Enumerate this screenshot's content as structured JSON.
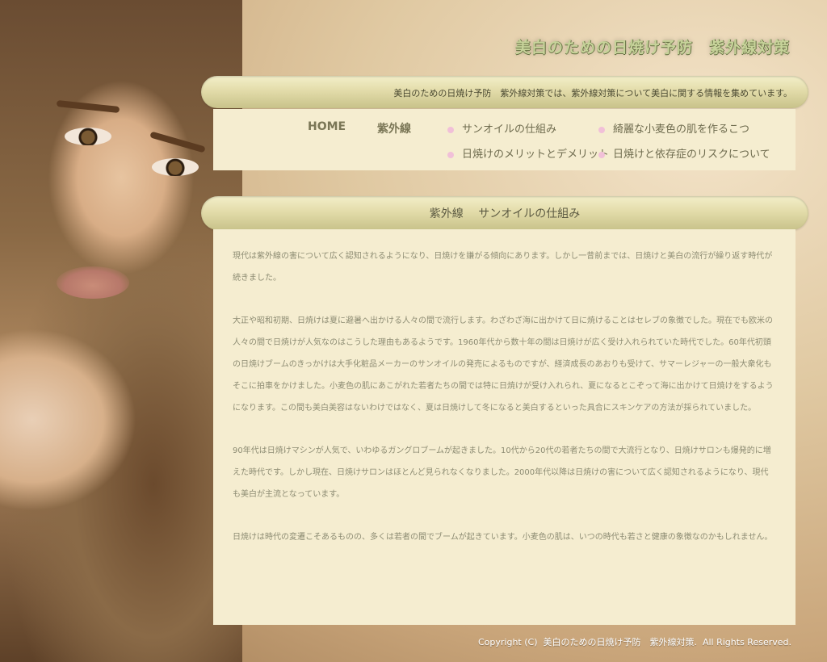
{
  "site_title": "美白のための日焼け予防　紫外線対策",
  "intro": "美白のための日焼け予防　紫外線対策では、紫外線対策について美白に関する情報を集めています。",
  "nav": {
    "home": "HOME",
    "section": "紫外線",
    "items": [
      "サンオイルの仕組み",
      "綺麗な小麦色の肌を作るこつ",
      "日焼けのメリットとデメリット",
      "日焼けと依存症のリスクについて"
    ]
  },
  "page_heading": "紫外線　 サンオイルの仕組み",
  "paragraphs": [
    "現代は紫外線の害について広く認知されるようになり、日焼けを嫌がる傾向にあります。しかし一昔前までは、日焼けと美白の流行が繰り返す時代が続きました。",
    "大正や昭和初期、日焼けは夏に避暑へ出かける人々の間で流行します。わざわざ海に出かけて日に焼けることはセレブの象徴でした。現在でも欧米の人々の間で日焼けが人気なのはこうした理由もあるようです。1960年代から数十年の間は日焼けが広く受け入れられていた時代でした。60年代初頭の日焼けブームのきっかけは大手化粧品メーカーのサンオイルの発売によるものですが、経済成長のあおりも受けて、サマーレジャーの一般大衆化もそこに拍車をかけました。小麦色の肌にあこがれた若者たちの間では特に日焼けが受け入れられ、夏になるとこぞって海に出かけて日焼けをするようになります。この間も美白美容はないわけではなく、夏は日焼けして冬になると美白するといった具合にスキンケアの方法が採られていました。",
    "90年代は日焼けマシンが人気で、いわゆるガングロブームが起きました。10代から20代の若者たちの間で大流行となり、日焼けサロンも爆発的に増えた時代です。しかし現在、日焼けサロンはほとんど見られなくなりました。2000年代以降は日焼けの害について広く認知されるようになり、現代も美白が主流となっています。",
    "日焼けは時代の変遷こそあるものの、多くは若者の間でブームが起きています。小麦色の肌は、いつの時代も若さと健康の象徴なのかもしれません。"
  ],
  "footer": "Copyright (C)  美白のための日焼け予防　紫外線対策.  All Rights Reserved."
}
